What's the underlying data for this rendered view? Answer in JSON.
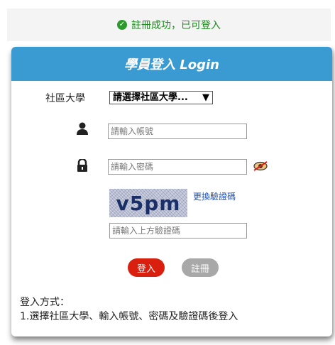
{
  "success_message": "註冊成功，已可登入",
  "login": {
    "header": "學員登入 Login",
    "university_label": "社區大學",
    "university_select": "請選擇社區大學...",
    "account_placeholder": "請輸入帳號",
    "password_placeholder": "請輸入密碼",
    "captcha_text": "v5pm",
    "refresh_captcha": "更換驗證碼",
    "captcha_placeholder": "請輸入上方驗證碼",
    "login_button": "登入",
    "register_button": "註冊"
  },
  "notes": {
    "title": "登入方式：",
    "line1": "1.選擇社區大學、輸入帳號、密碼及驗證碼後登入"
  }
}
